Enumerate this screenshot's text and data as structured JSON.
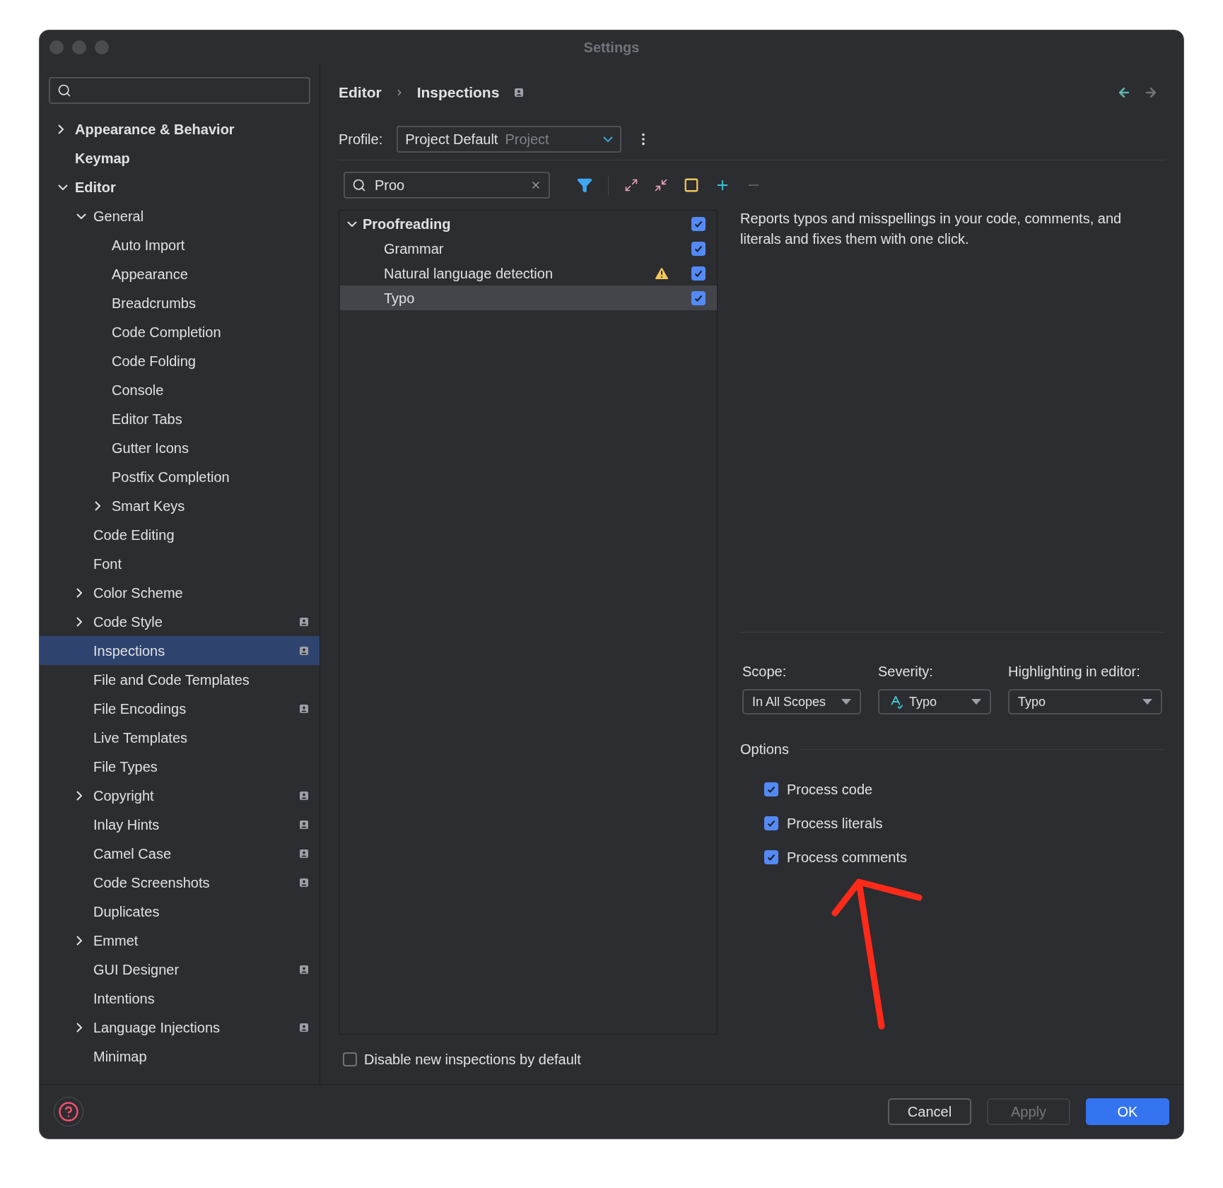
{
  "window": {
    "title": "Settings"
  },
  "sidebar": {
    "items": [
      {
        "label": "Appearance & Behavior",
        "bold": true,
        "expanded": false,
        "selected": false,
        "scoped": false
      },
      {
        "label": "Keymap",
        "bold": true,
        "selected": false,
        "scoped": false
      },
      {
        "label": "Editor",
        "bold": true,
        "expanded": true,
        "selected": false,
        "scoped": false,
        "children": [
          {
            "label": "General",
            "bold": false,
            "expanded": true,
            "selected": false,
            "scoped": false,
            "children": [
              {
                "label": "Auto Import",
                "bold": false,
                "selected": false,
                "scoped": false
              },
              {
                "label": "Appearance",
                "bold": false,
                "selected": false,
                "scoped": false
              },
              {
                "label": "Breadcrumbs",
                "bold": false,
                "selected": false,
                "scoped": false
              },
              {
                "label": "Code Completion",
                "bold": false,
                "selected": false,
                "scoped": false
              },
              {
                "label": "Code Folding",
                "bold": false,
                "selected": false,
                "scoped": false
              },
              {
                "label": "Console",
                "bold": false,
                "selected": false,
                "scoped": false
              },
              {
                "label": "Editor Tabs",
                "bold": false,
                "selected": false,
                "scoped": false
              },
              {
                "label": "Gutter Icons",
                "bold": false,
                "selected": false,
                "scoped": false
              },
              {
                "label": "Postfix Completion",
                "bold": false,
                "selected": false,
                "scoped": false
              },
              {
                "label": "Smart Keys",
                "bold": false,
                "expanded": false,
                "selected": false,
                "scoped": false
              }
            ]
          },
          {
            "label": "Code Editing",
            "bold": false,
            "selected": false,
            "scoped": false
          },
          {
            "label": "Font",
            "bold": false,
            "selected": false,
            "scoped": false
          },
          {
            "label": "Color Scheme",
            "bold": false,
            "expanded": false,
            "selected": false,
            "scoped": false
          },
          {
            "label": "Code Style",
            "bold": false,
            "expanded": false,
            "selected": false,
            "scoped": true
          },
          {
            "label": "Inspections",
            "bold": false,
            "selected": true,
            "scoped": true
          },
          {
            "label": "File and Code Templates",
            "bold": false,
            "selected": false,
            "scoped": false
          },
          {
            "label": "File Encodings",
            "bold": false,
            "selected": false,
            "scoped": true
          },
          {
            "label": "Live Templates",
            "bold": false,
            "selected": false,
            "scoped": false
          },
          {
            "label": "File Types",
            "bold": false,
            "selected": false,
            "scoped": false
          },
          {
            "label": "Copyright",
            "bold": false,
            "expanded": false,
            "selected": false,
            "scoped": true
          },
          {
            "label": "Inlay Hints",
            "bold": false,
            "selected": false,
            "scoped": true
          },
          {
            "label": "Camel Case",
            "bold": false,
            "selected": false,
            "scoped": true
          },
          {
            "label": "Code Screenshots",
            "bold": false,
            "selected": false,
            "scoped": true
          },
          {
            "label": "Duplicates",
            "bold": false,
            "selected": false,
            "scoped": false
          },
          {
            "label": "Emmet",
            "bold": false,
            "expanded": false,
            "selected": false,
            "scoped": false
          },
          {
            "label": "GUI Designer",
            "bold": false,
            "selected": false,
            "scoped": true
          },
          {
            "label": "Intentions",
            "bold": false,
            "selected": false,
            "scoped": false
          },
          {
            "label": "Language Injections",
            "bold": false,
            "expanded": false,
            "selected": false,
            "scoped": true
          },
          {
            "label": "Minimap",
            "bold": false,
            "selected": false,
            "scoped": false
          }
        ]
      }
    ]
  },
  "header": {
    "breadcrumb": [
      "Editor",
      "Inspections"
    ],
    "scoped": true
  },
  "profile": {
    "label": "Profile:",
    "value": "Project Default",
    "hint": "Project"
  },
  "filter": {
    "value": "Proo"
  },
  "inspections": [
    {
      "label": "Proofreading",
      "expanded": true,
      "checked": true,
      "selected": false,
      "warning": false,
      "children": [
        {
          "label": "Grammar",
          "checked": true,
          "selected": false,
          "warning": false
        },
        {
          "label": "Natural language detection",
          "checked": true,
          "selected": false,
          "warning": true
        },
        {
          "label": "Typo",
          "checked": true,
          "selected": true,
          "warning": false
        }
      ]
    }
  ],
  "description": "Reports typos and misspellings in your code, comments, and literals and fixes them with one click.",
  "scope": {
    "label": "Scope:",
    "value": "In All Scopes"
  },
  "severity": {
    "label": "Severity:",
    "value": "Typo"
  },
  "highlighting": {
    "label": "Highlighting in editor:",
    "value": "Typo"
  },
  "options": {
    "title": "Options",
    "items": [
      {
        "label": "Process code",
        "checked": true
      },
      {
        "label": "Process literals",
        "checked": true
      },
      {
        "label": "Process comments",
        "checked": true
      }
    ]
  },
  "disable_new": {
    "label": "Disable new inspections by default",
    "checked": false
  },
  "buttons": [
    {
      "label": "Cancel",
      "kind": "secondary",
      "disabled": false
    },
    {
      "label": "Apply",
      "kind": "secondary",
      "disabled": true
    },
    {
      "label": "OK",
      "kind": "primary",
      "disabled": false
    }
  ]
}
